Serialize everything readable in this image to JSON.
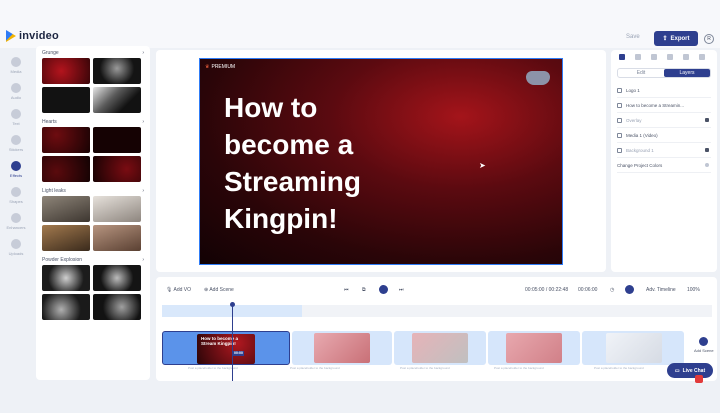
{
  "app": {
    "name": "invideo"
  },
  "header": {
    "save_label": "Save",
    "export_label": "Export",
    "avatar_initial": "R"
  },
  "leftnav": {
    "items": [
      {
        "label": "Media",
        "icon": "media-icon",
        "active": false
      },
      {
        "label": "Audio",
        "icon": "audio-icon",
        "active": false
      },
      {
        "label": "Text",
        "icon": "text-icon",
        "active": false
      },
      {
        "label": "Stickers",
        "icon": "stickers-icon",
        "active": false
      },
      {
        "label": "Effects",
        "icon": "effects-icon",
        "active": true
      },
      {
        "label": "Shapes",
        "icon": "shapes-icon",
        "active": false
      },
      {
        "label": "Enhancers",
        "icon": "enhancers-icon",
        "active": false
      },
      {
        "label": "Uploads",
        "icon": "uploads-icon",
        "active": false
      }
    ]
  },
  "effects": {
    "groups": [
      {
        "title": "Grunge",
        "thumbs": [
          "#7a0c12",
          "#2b2b2b",
          "#141414",
          "#3a3a3a"
        ]
      },
      {
        "title": "Hearts",
        "thumbs": [
          "#3a0608",
          "#1c0203",
          "#220406",
          "#2d0507"
        ]
      },
      {
        "title": "Light leaks",
        "thumbs": [
          "#6b6258",
          "#b9b0a8",
          "#7a5a3a",
          "#8a6a54"
        ]
      },
      {
        "title": "Powder Explosion",
        "thumbs": [
          "#4e4e4e",
          "#2e2e2e",
          "#3c3c3c",
          "#1e1e1e"
        ]
      }
    ]
  },
  "canvas": {
    "premium_label": "PREMIUM",
    "headline": "How to become a Streaming Kingpin!"
  },
  "layers": {
    "tabs": [
      {
        "label": "Edit",
        "active": false
      },
      {
        "label": "Layers",
        "active": true
      }
    ],
    "items": [
      {
        "label": "Logo 1",
        "dim": false,
        "locked": false
      },
      {
        "label": "How to become a Streamin...",
        "dim": false,
        "locked": false
      },
      {
        "label": "Overlay",
        "dim": true,
        "locked": true
      },
      {
        "label": "Media 1 (Video)",
        "dim": false,
        "locked": false
      },
      {
        "label": "Background 1",
        "dim": true,
        "locked": true
      },
      {
        "label": "Change Project Colors",
        "dim": false,
        "locked": false
      }
    ]
  },
  "timeline": {
    "add_vo": "Add VO",
    "add_scene": "Add Scene",
    "time": "00:05:00 / 00:22:48",
    "duration": "00:06:00",
    "adv_timeline": "Adv. Timeline",
    "zoom": "100%",
    "clip_caption": "Post a placeholder to the background",
    "add_scene_right": "Add Scene",
    "clip_text_a": "How to become a Stream Kingpin!",
    "clip_time_tag": "00:00"
  },
  "chat": {
    "label": "Live Chat"
  },
  "colors": {
    "accent": "#2e3f8f",
    "video_red": "#a4141a",
    "clip_blue": "#5b93ea"
  }
}
